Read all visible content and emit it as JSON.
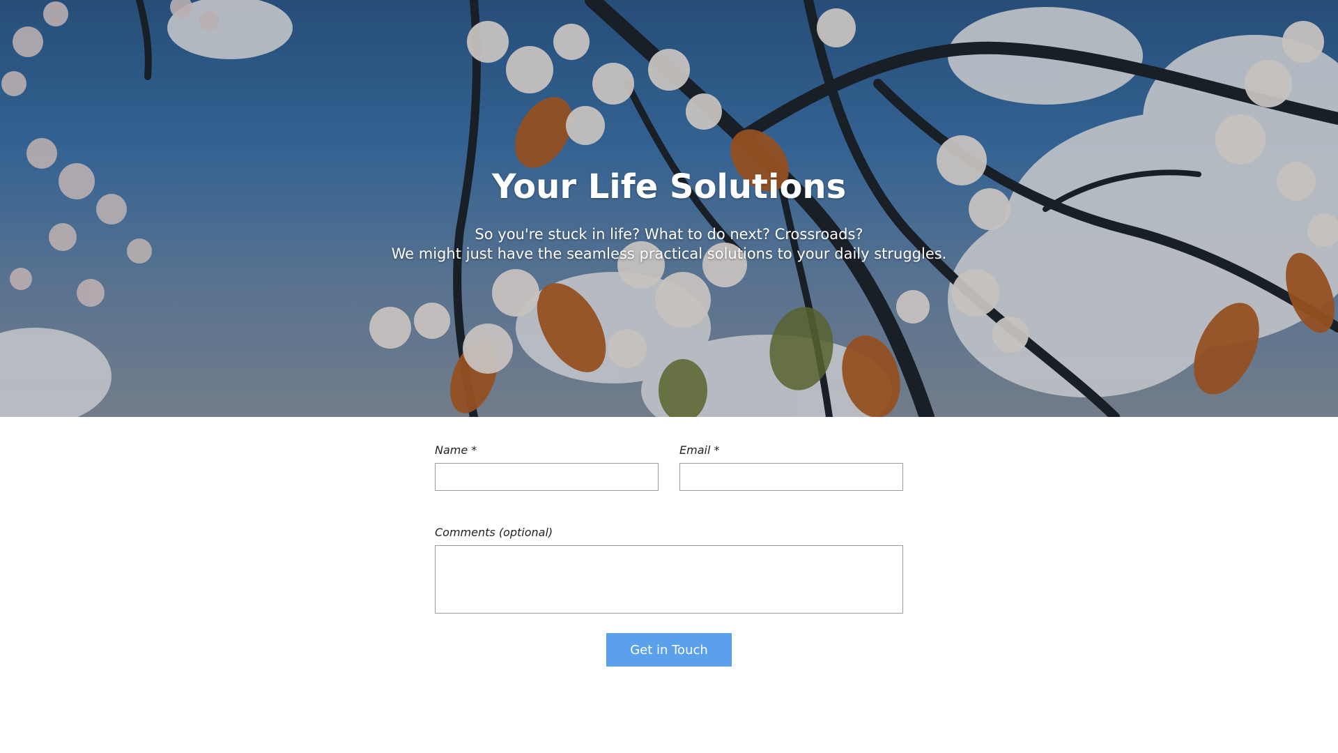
{
  "hero": {
    "title": "Your Life Solutions",
    "subtitle_line1": "So you're stuck in life? What to do next? Crossroads?",
    "subtitle_line2": "We might just have the seamless practical solutions to your daily struggles.",
    "background": "cherry blossom branches against blue sky with clouds"
  },
  "form": {
    "name_label": "Name *",
    "name_value": "",
    "email_label": "Email *",
    "email_value": "",
    "comments_label": "Comments (optional)",
    "comments_value": "",
    "submit_label": "Get in Touch"
  },
  "colors": {
    "button": "#5aa0ea",
    "sky": "#3f78b2"
  }
}
